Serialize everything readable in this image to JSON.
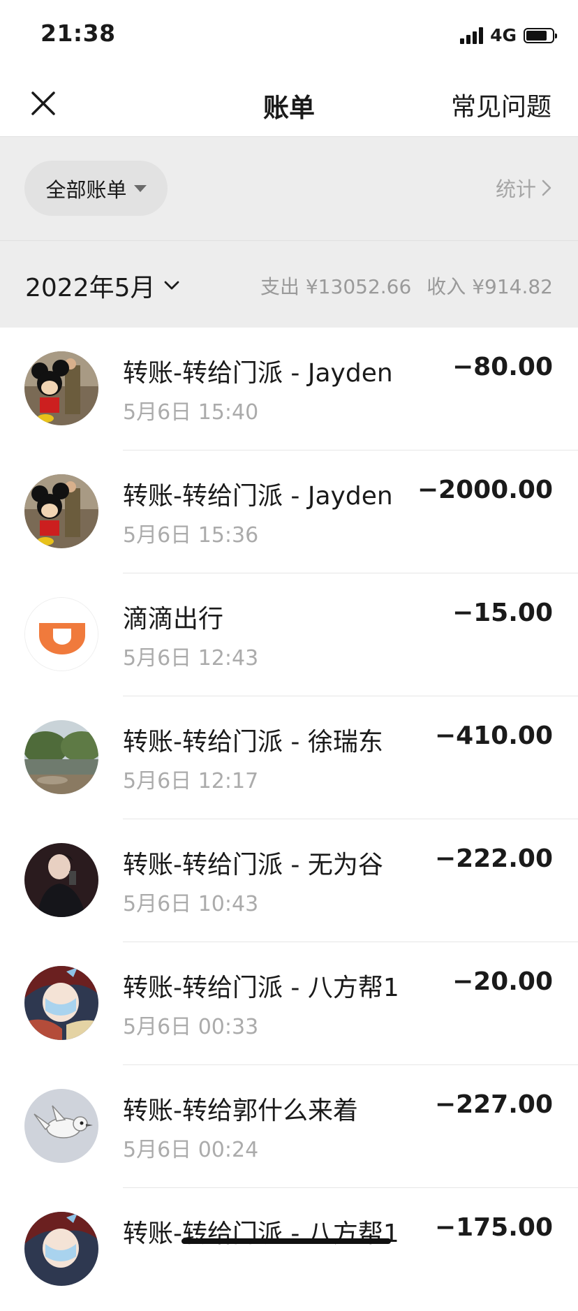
{
  "status_bar": {
    "time": "21:38",
    "network": "4G",
    "battery_level": 0.85
  },
  "nav": {
    "title": "账单",
    "faq": "常见问题",
    "close_icon": "close-icon"
  },
  "filter": {
    "label": "全部账单",
    "stats": "统计"
  },
  "month": {
    "label": "2022年5月",
    "expense": "支出 ¥13052.66",
    "income": "收入 ¥914.82"
  },
  "transactions": [
    {
      "title": "转账-转给门派 - Jayden",
      "time": "5月6日 15:40",
      "amount": "−80.00",
      "avatar": "mickey-avatar"
    },
    {
      "title": "转账-转给门派 - Jayden",
      "time": "5月6日 15:36",
      "amount": "−2000.00",
      "avatar": "mickey-avatar"
    },
    {
      "title": "滴滴出行",
      "time": "5月6日 12:43",
      "amount": "−15.00",
      "avatar": "didi-logo"
    },
    {
      "title": "转账-转给门派 - 徐瑞东",
      "time": "5月6日 12:17",
      "amount": "−410.00",
      "avatar": "landscape-avatar"
    },
    {
      "title": "转账-转给门派 - 无为谷",
      "time": "5月6日 10:43",
      "amount": "−222.00",
      "avatar": "person-avatar"
    },
    {
      "title": "转账-转给门派 - 八方帮1",
      "time": "5月6日 00:33",
      "amount": "−20.00",
      "avatar": "anime-avatar"
    },
    {
      "title": "转账-转给郭什么来着",
      "time": "5月6日 00:24",
      "amount": "−227.00",
      "avatar": "bird-avatar"
    },
    {
      "title": "转账-转给门派 - 八方帮1",
      "time": "",
      "amount": "−175.00",
      "avatar": "anime-avatar"
    }
  ],
  "colors": {
    "didi_orange": "#f07a3c",
    "header_bg": "#ededed",
    "secondary_text": "#ababab"
  }
}
